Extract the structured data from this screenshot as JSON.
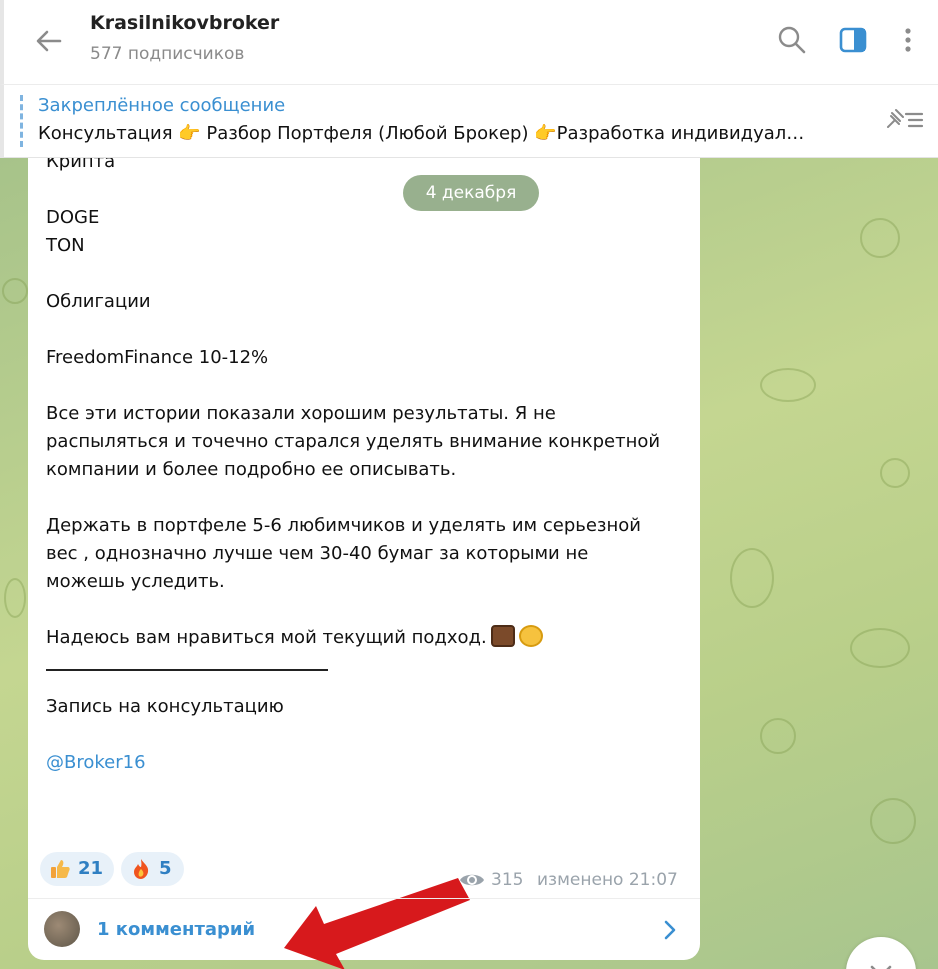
{
  "header": {
    "title": "Krasilnikovbroker",
    "subtitle": "577 подписчиков"
  },
  "pinned": {
    "title": "Закреплённое сообщение",
    "text": "Консультация  👉 Разбор Портфеля (Любой Брокер) 👉Разработка индивидуал…"
  },
  "date_badge": "4 декабря",
  "message": {
    "lines": {
      "crypto": "Крипта",
      "doge": "DOGE",
      "ton": "TON",
      "bonds": "Облигации",
      "freedom": "FreedomFinance 10-12%",
      "p1_l1": "Все эти истории показали хорошим результаты. Я не",
      "p1_l2": "распыляться и точечно старался уделять внимание конкретной",
      "p1_l3": "компании и более подробно ее описывать.",
      "p2_l1": "Держать в портфеле 5-6 любимчиков и уделять им серьезной",
      "p2_l2": "вес , однозначно лучше чем  30-40 бумаг за которыми не",
      "p2_l3": "можешь уследить.",
      "p3": "Надеюсь вам нравиться мой текущий подход.",
      "signup": "Запись на консультацию",
      "contact": "@Broker16"
    },
    "emojis": [
      "briefcase-icon",
      "money-mouth-face-icon"
    ]
  },
  "reactions": [
    {
      "icon": "thumbs-up-icon",
      "count": "21"
    },
    {
      "icon": "fire-icon",
      "count": "5"
    }
  ],
  "meta": {
    "views": "315",
    "edited": "изменено 21:07"
  },
  "comments": {
    "label": "1 комментарий"
  },
  "colors": {
    "accent": "#3a8fd1",
    "arrow": "#d7191c",
    "chat_bg": "#b9cf8a"
  }
}
